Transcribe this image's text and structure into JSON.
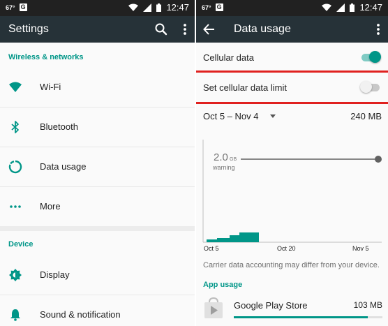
{
  "colors": {
    "accent": "#009688",
    "appbar": "#263238",
    "statusbar": "#212121",
    "highlight": "#e0211f"
  },
  "left": {
    "status": {
      "temp": "67°",
      "g": "G",
      "time": "12:47"
    },
    "appbar": {
      "title": "Settings",
      "icons": [
        "search-icon",
        "overflow-menu-icon"
      ]
    },
    "sections": [
      {
        "header": "Wireless & networks",
        "items": [
          {
            "label": "Wi-Fi",
            "icon": "wifi-icon"
          },
          {
            "label": "Bluetooth",
            "icon": "bluetooth-icon"
          },
          {
            "label": "Data usage",
            "icon": "data-usage-icon"
          },
          {
            "label": "More",
            "icon": "more-dots-icon"
          }
        ]
      },
      {
        "header": "Device",
        "items": [
          {
            "label": "Display",
            "icon": "display-brightness-icon"
          },
          {
            "label": "Sound & notification",
            "icon": "bell-icon"
          }
        ]
      }
    ]
  },
  "right": {
    "status": {
      "temp": "67°",
      "g": "G",
      "time": "12:47"
    },
    "appbar": {
      "title": "Data usage",
      "icons": [
        "back-arrow-icon",
        "overflow-menu-icon"
      ]
    },
    "cellular_data": {
      "label": "Cellular data",
      "enabled": true
    },
    "data_limit": {
      "label": "Set cellular data limit",
      "enabled": false
    },
    "cycle": {
      "range": "Oct 5 – Nov 4",
      "total": "240 MB"
    },
    "chart_data": {
      "type": "area",
      "x_labels": [
        "Oct 5",
        "Oct 20",
        "Nov 5"
      ],
      "warning": {
        "value": "2.0",
        "unit": "GB",
        "label": "warning"
      },
      "usage_fraction_of_warning": 0.12
    },
    "note": "Carrier data accounting may differ from your device.",
    "app_usage": {
      "header": "App usage",
      "apps": [
        {
          "name": "Google Play Store",
          "size": "103 MB",
          "fraction": 0.9,
          "icon": "play-store-icon"
        }
      ]
    }
  }
}
